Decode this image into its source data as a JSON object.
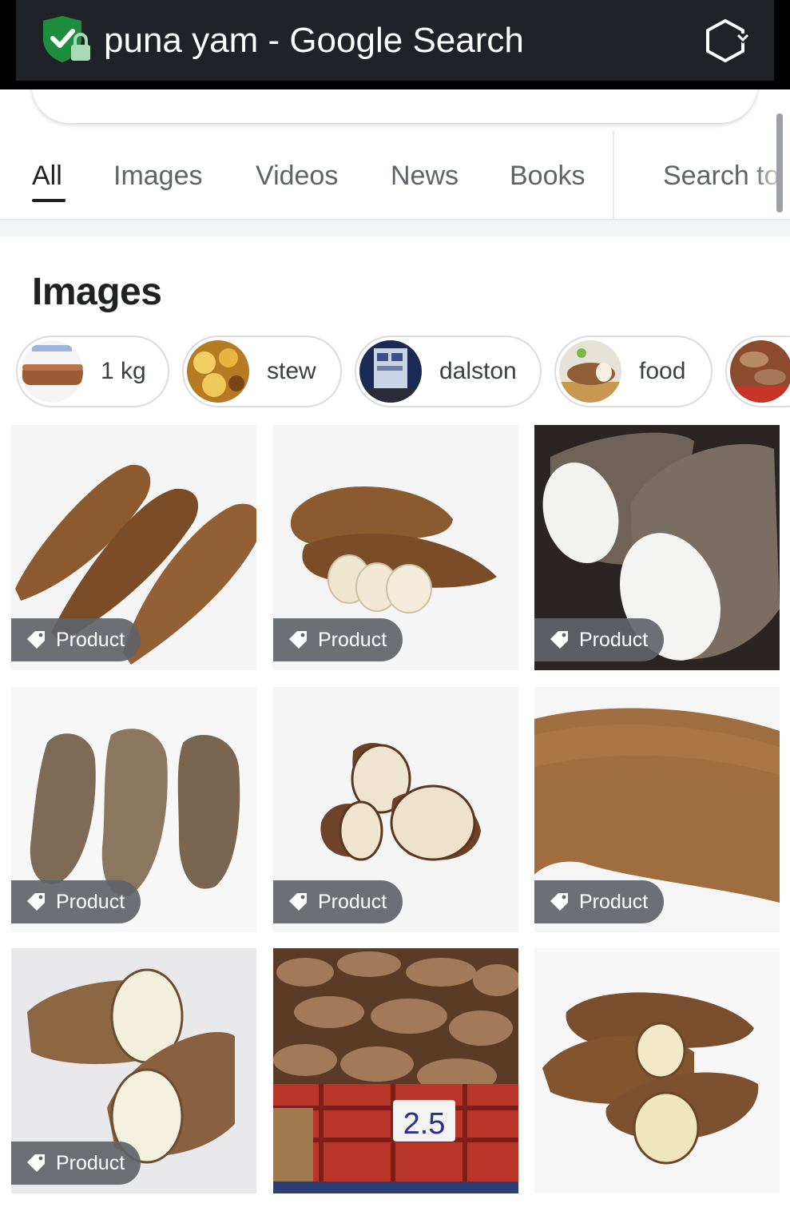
{
  "window": {
    "title": "puna yam - Google Search",
    "icons": {
      "security": "shield-lock-icon",
      "tabs": "tab-switcher-icon"
    }
  },
  "nav": {
    "tabs": [
      {
        "label": "All",
        "active": true
      },
      {
        "label": "Images",
        "active": false
      },
      {
        "label": "Videos",
        "active": false
      },
      {
        "label": "News",
        "active": false
      },
      {
        "label": "Books",
        "active": false
      },
      {
        "label": "Search to",
        "active": false
      }
    ]
  },
  "images_section": {
    "title": "Images",
    "chips": [
      {
        "label": "1 kg"
      },
      {
        "label": "stew"
      },
      {
        "label": "dalston"
      },
      {
        "label": "food"
      },
      {
        "label": ""
      }
    ],
    "results": [
      {
        "badge": "Product"
      },
      {
        "badge": "Product"
      },
      {
        "badge": "Product"
      },
      {
        "badge": "Product"
      },
      {
        "badge": "Product"
      },
      {
        "badge": "Product"
      },
      {
        "badge": "Product"
      },
      {
        "badge": ""
      },
      {
        "badge": ""
      }
    ],
    "market_sign": "2.5"
  },
  "colors": {
    "title_bar": "#1f2327",
    "shield_green": "#1e8e3e",
    "badge_bg": "#5f6368",
    "yam_brown": "#8a5a33"
  }
}
